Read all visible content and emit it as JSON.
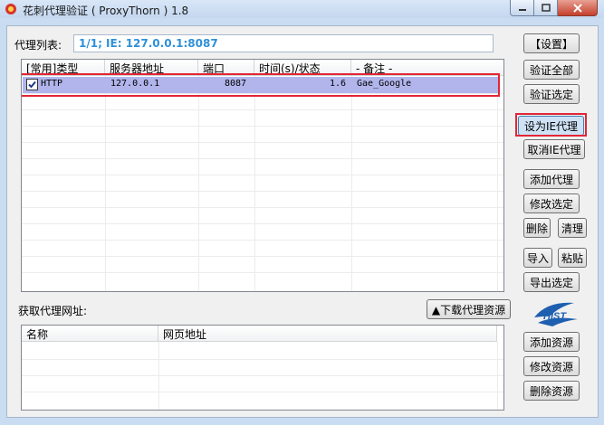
{
  "window": {
    "title": "花刺代理验证 ( ProxyThorn ) 1.8"
  },
  "proxy_list": {
    "label": "代理列表:",
    "summary": "1/1;   IE: 127.0.0.1:8087",
    "columns": [
      "[常用]类型",
      "服务器地址",
      "端口",
      "时间(s)/状态",
      "- 备注 -"
    ],
    "rows": [
      {
        "type": "HTTP",
        "address": "127.0.0.1",
        "port": "8087",
        "time": "1.6",
        "note": "Gae_Google",
        "checked": true
      }
    ]
  },
  "source": {
    "label": "获取代理网址:",
    "download_button": "▲下载代理资源",
    "columns": [
      "名称",
      "网页地址"
    ]
  },
  "buttons": {
    "settings": "【设置】",
    "verify_all": "验证全部",
    "verify_selected": "验证选定",
    "set_ie_proxy": "设为IE代理",
    "cancel_ie_proxy": "取消IE代理",
    "add_proxy": "添加代理",
    "edit_selected": "修改选定",
    "delete": "删除",
    "clear": "清理",
    "import": "导入",
    "paste": "粘贴",
    "export_selected": "导出选定",
    "add_source": "添加资源",
    "edit_source": "修改资源",
    "delete_source": "删除资源"
  },
  "logo": {
    "text": "HIST"
  },
  "colors": {
    "selection": "#b1b5ec",
    "highlight_border": "#e32636",
    "summary_text": "#2e90d8"
  }
}
